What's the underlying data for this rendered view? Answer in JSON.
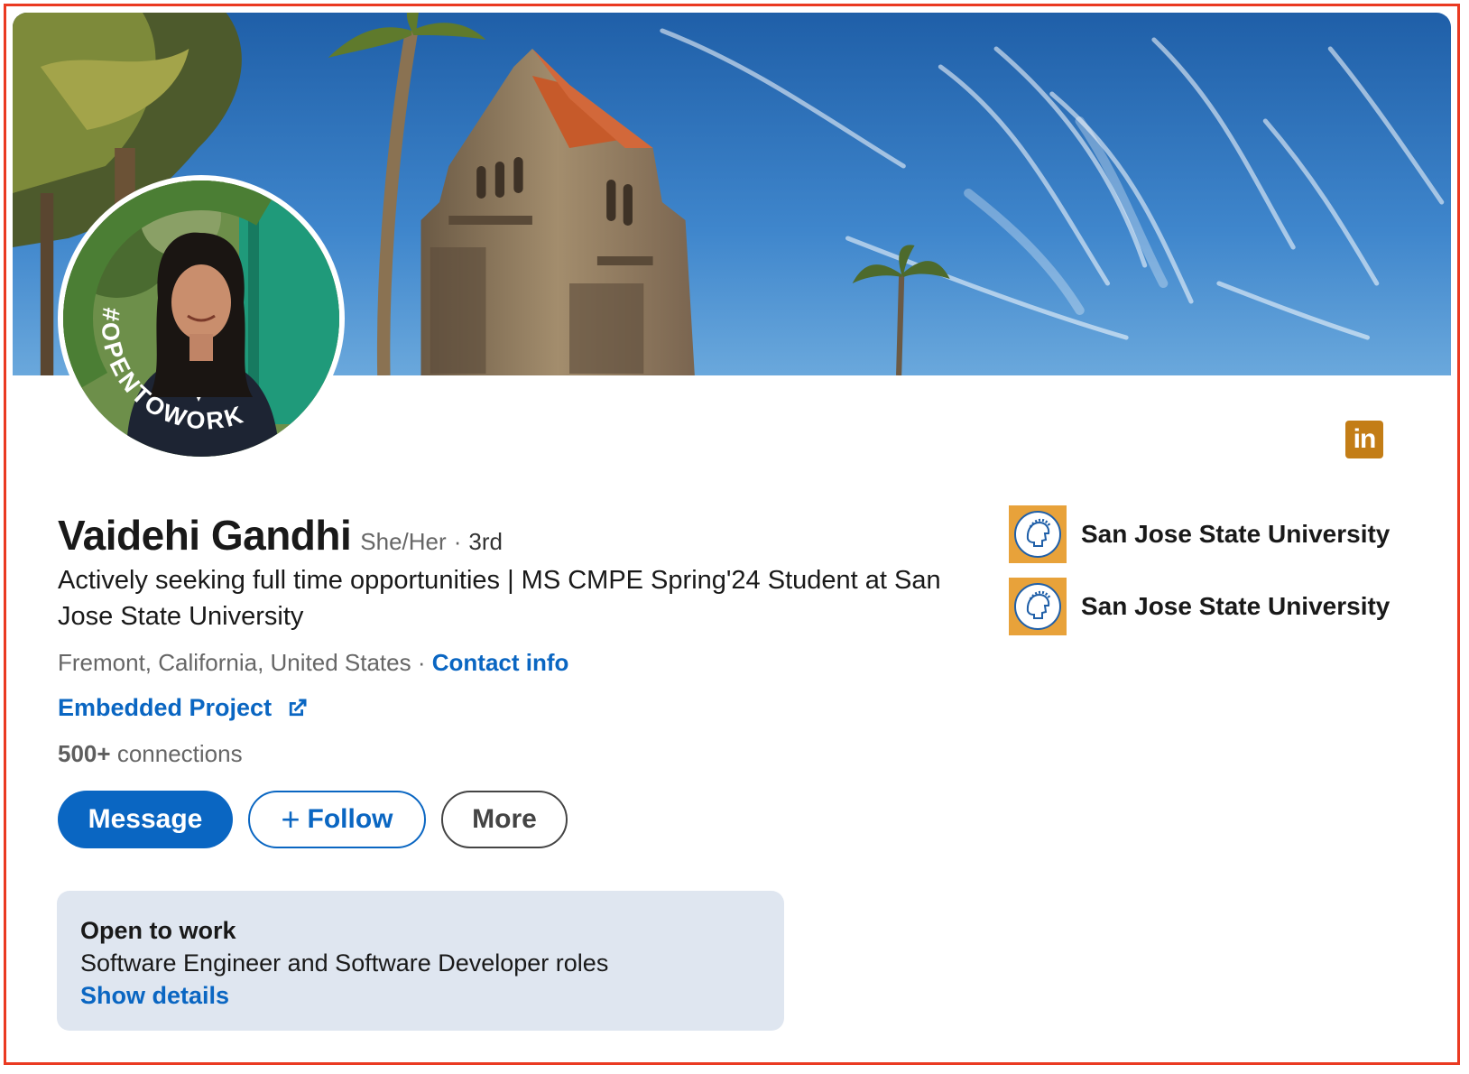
{
  "profile": {
    "name": "Vaidehi Gandhi",
    "pronouns": "She/Her",
    "separator": "·",
    "degree": "3rd",
    "headline": "Actively seeking full time opportunities | MS CMPE Spring'24 Student at San Jose State University",
    "location": "Fremont, California, United States",
    "contact_info_label": "Contact info",
    "website_label": "Embedded Project",
    "connections_count": "500+",
    "connections_label": "connections",
    "avatar_frame_text": "#OPENTOWORK",
    "brand_badge_text": "in"
  },
  "actions": {
    "message_label": "Message",
    "follow_plus": "+",
    "follow_label": "Follow",
    "more_label": "More"
  },
  "open_to_work": {
    "title": "Open to work",
    "description": "Software Engineer and Software Developer roles",
    "link_label": "Show details"
  },
  "education": [
    {
      "name": "San Jose State University",
      "logo_icon": "spartan-head-icon"
    },
    {
      "name": "San Jose State University",
      "logo_icon": "spartan-head-icon"
    }
  ],
  "colors": {
    "brand_blue": "#0a66c2",
    "open_to_work_green": "#4b7e34",
    "badge_gold": "#c37d16",
    "frame_red": "#ea3a22"
  }
}
